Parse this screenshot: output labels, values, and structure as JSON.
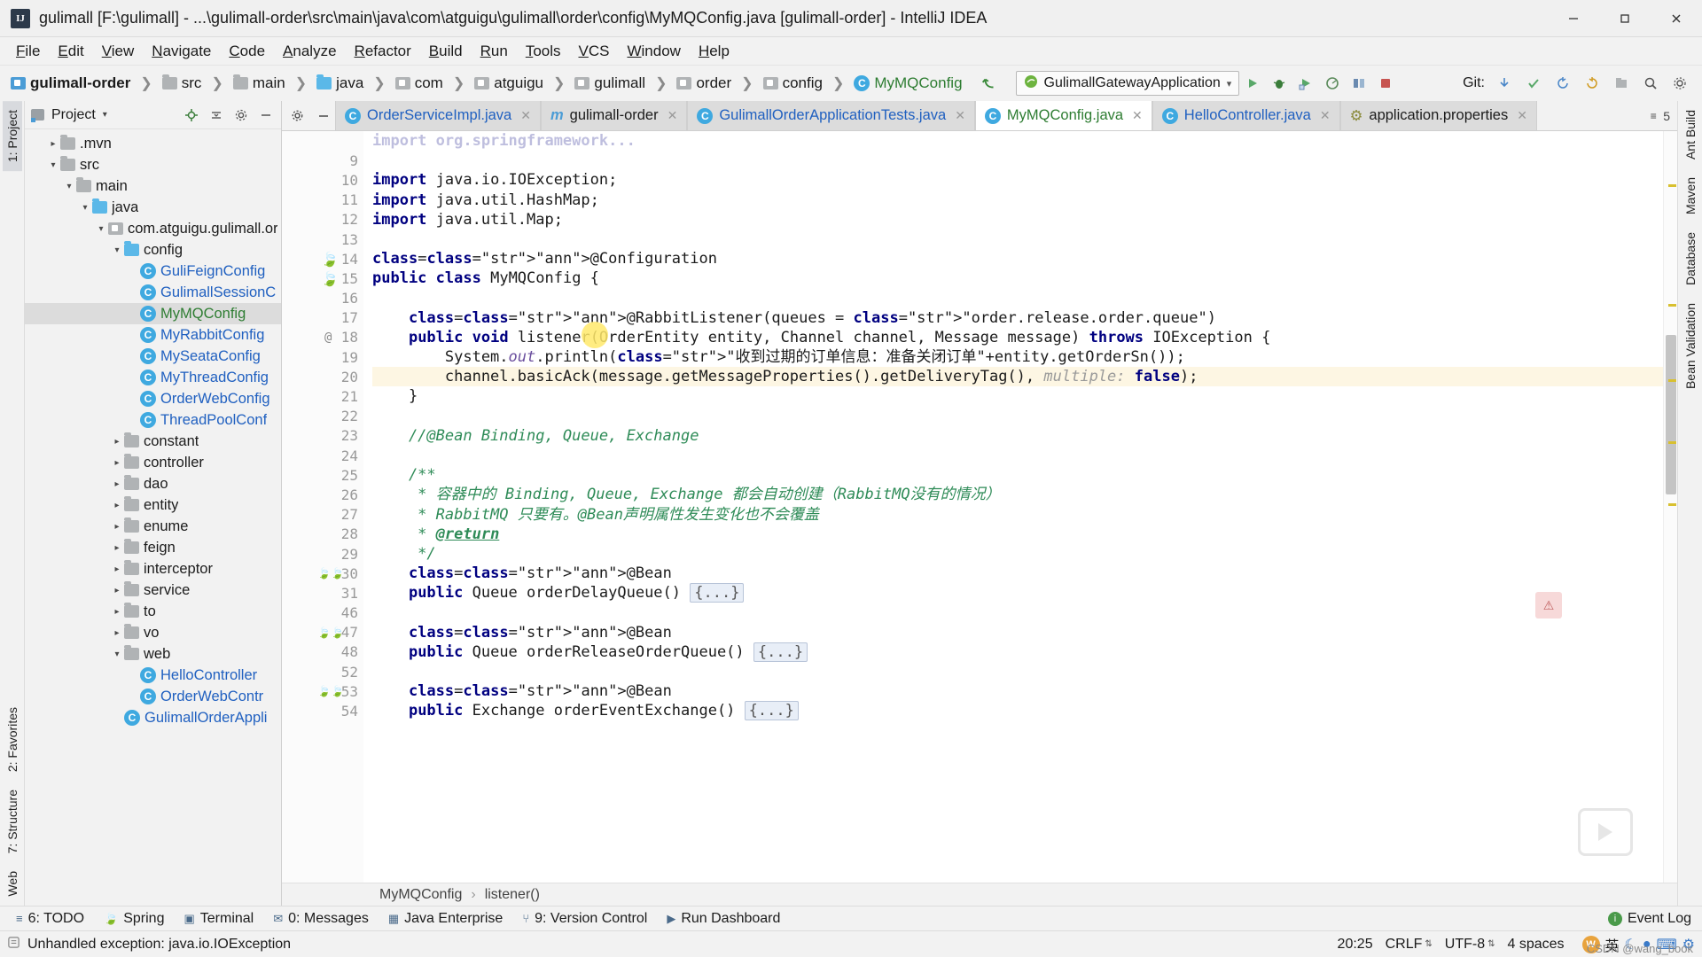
{
  "window": {
    "title": "gulimall [F:\\gulimall] - ...\\gulimall-order\\src\\main\\java\\com\\atguigu\\gulimall\\order\\config\\MyMQConfig.java [gulimall-order] - IntelliJ IDEA",
    "icon": "intellij-idea-icon",
    "minimize": "minimize-icon",
    "maximize": "restore-icon",
    "close": "close-icon"
  },
  "menubar": {
    "items": [
      {
        "label": "File"
      },
      {
        "label": "Edit"
      },
      {
        "label": "View"
      },
      {
        "label": "Navigate"
      },
      {
        "label": "Code"
      },
      {
        "label": "Analyze"
      },
      {
        "label": "Refactor"
      },
      {
        "label": "Build"
      },
      {
        "label": "Run"
      },
      {
        "label": "Tools"
      },
      {
        "label": "VCS"
      },
      {
        "label": "Window"
      },
      {
        "label": "Help"
      }
    ]
  },
  "navbar": {
    "breadcrumbs": [
      {
        "label": "gulimall-order",
        "icon": "module-icon",
        "style": "bold"
      },
      {
        "label": "src",
        "icon": "folder-grey-icon",
        "style": "normal"
      },
      {
        "label": "main",
        "icon": "folder-grey-icon",
        "style": "normal"
      },
      {
        "label": "java",
        "icon": "folder-source-blue-icon",
        "style": "normal"
      },
      {
        "label": "com",
        "icon": "package-icon",
        "style": "normal"
      },
      {
        "label": "atguigu",
        "icon": "package-icon",
        "style": "normal"
      },
      {
        "label": "gulimall",
        "icon": "package-icon",
        "style": "normal"
      },
      {
        "label": "order",
        "icon": "package-icon",
        "style": "normal"
      },
      {
        "label": "config",
        "icon": "package-icon",
        "style": "normal"
      },
      {
        "label": "MyMQConfig",
        "icon": "class-icon",
        "style": "green"
      }
    ],
    "run_config": {
      "label": "GulimallGatewayApplication",
      "icon": "spring-boot-icon",
      "dropdown": "chevron-down-icon"
    },
    "git_label": "Git:",
    "toolbar_icons": [
      "run-icon",
      "debug-icon",
      "run-with-coverage-icon",
      "profiler-icon",
      "build-icon",
      "stop-icon",
      "update-project-icon",
      "commit-icon",
      "rollback-icon",
      "search-everywhere-icon",
      "settings-icon"
    ]
  },
  "left_rail": {
    "items": [
      {
        "label": "1: Project",
        "icon": "project-icon",
        "selected": true
      },
      {
        "label": "2: Favorites",
        "icon": "favorites-icon",
        "selected": false
      },
      {
        "label": "7: Structure",
        "icon": "structure-icon",
        "selected": false
      },
      {
        "label": "Web",
        "icon": "web-icon",
        "selected": false
      }
    ]
  },
  "right_rail": {
    "items": [
      {
        "label": "Ant Build",
        "icon": "ant-icon"
      },
      {
        "label": "Maven",
        "icon": "maven-icon"
      },
      {
        "label": "Database",
        "icon": "database-icon"
      },
      {
        "label": "Bean Validation",
        "icon": "bean-validation-icon"
      }
    ]
  },
  "project_panel": {
    "title": "Project",
    "title_caret": "chevron-down-icon",
    "header_icons": [
      "locate-icon",
      "collapse-all-icon",
      "settings-gear-icon",
      "hide-icon"
    ],
    "tree": [
      {
        "depth": 1,
        "label": ".mvn",
        "arrow": "right",
        "icon": "folder",
        "color": "default",
        "selected": false
      },
      {
        "depth": 1,
        "label": "src",
        "arrow": "down",
        "icon": "folder",
        "color": "default",
        "selected": false
      },
      {
        "depth": 2,
        "label": "main",
        "arrow": "down",
        "icon": "folder",
        "color": "default",
        "selected": false
      },
      {
        "depth": 3,
        "label": "java",
        "arrow": "down",
        "icon": "folder-blue",
        "color": "default",
        "selected": false
      },
      {
        "depth": 4,
        "label": "com.atguigu.gulimall.or",
        "arrow": "down",
        "icon": "package",
        "color": "default",
        "selected": false
      },
      {
        "depth": 5,
        "label": "config",
        "arrow": "down",
        "icon": "folder-blue",
        "color": "default",
        "selected": false
      },
      {
        "depth": 6,
        "label": "GuliFeignConfig",
        "arrow": "none",
        "icon": "class",
        "color": "blue",
        "selected": false
      },
      {
        "depth": 6,
        "label": "GulimallSessionC",
        "arrow": "none",
        "icon": "class",
        "color": "blue",
        "selected": false
      },
      {
        "depth": 6,
        "label": "MyMQConfig",
        "arrow": "none",
        "icon": "class",
        "color": "green",
        "selected": true
      },
      {
        "depth": 6,
        "label": "MyRabbitConfig",
        "arrow": "none",
        "icon": "class",
        "color": "blue",
        "selected": false
      },
      {
        "depth": 6,
        "label": "MySeataConfig",
        "arrow": "none",
        "icon": "class",
        "color": "blue",
        "selected": false
      },
      {
        "depth": 6,
        "label": "MyThreadConfig",
        "arrow": "none",
        "icon": "class",
        "color": "blue",
        "selected": false
      },
      {
        "depth": 6,
        "label": "OrderWebConfig",
        "arrow": "none",
        "icon": "class",
        "color": "blue",
        "selected": false
      },
      {
        "depth": 6,
        "label": "ThreadPoolConf",
        "arrow": "none",
        "icon": "class",
        "color": "blue",
        "selected": false
      },
      {
        "depth": 5,
        "label": "constant",
        "arrow": "right",
        "icon": "folder",
        "color": "default",
        "selected": false
      },
      {
        "depth": 5,
        "label": "controller",
        "arrow": "right",
        "icon": "folder",
        "color": "default",
        "selected": false
      },
      {
        "depth": 5,
        "label": "dao",
        "arrow": "right",
        "icon": "folder",
        "color": "default",
        "selected": false
      },
      {
        "depth": 5,
        "label": "entity",
        "arrow": "right",
        "icon": "folder",
        "color": "default",
        "selected": false
      },
      {
        "depth": 5,
        "label": "enume",
        "arrow": "right",
        "icon": "folder",
        "color": "default",
        "selected": false
      },
      {
        "depth": 5,
        "label": "feign",
        "arrow": "right",
        "icon": "folder",
        "color": "default",
        "selected": false
      },
      {
        "depth": 5,
        "label": "interceptor",
        "arrow": "right",
        "icon": "folder",
        "color": "default",
        "selected": false
      },
      {
        "depth": 5,
        "label": "service",
        "arrow": "right",
        "icon": "folder",
        "color": "default",
        "selected": false
      },
      {
        "depth": 5,
        "label": "to",
        "arrow": "right",
        "icon": "folder",
        "color": "default",
        "selected": false
      },
      {
        "depth": 5,
        "label": "vo",
        "arrow": "right",
        "icon": "folder",
        "color": "default",
        "selected": false
      },
      {
        "depth": 5,
        "label": "web",
        "arrow": "down",
        "icon": "folder",
        "color": "default",
        "selected": false
      },
      {
        "depth": 6,
        "label": "HelloController",
        "arrow": "none",
        "icon": "class",
        "color": "blue",
        "selected": false
      },
      {
        "depth": 6,
        "label": "OrderWebContr",
        "arrow": "none",
        "icon": "class",
        "color": "blue",
        "selected": false
      },
      {
        "depth": 5,
        "label": "GulimallOrderAppli",
        "arrow": "none",
        "icon": "class-spring",
        "color": "blue",
        "selected": false
      }
    ]
  },
  "editor_tabs": {
    "gear_icon": "settings-gear-icon",
    "minimize_icon": "minimize-icon",
    "tabs": [
      {
        "label": "OrderServiceImpl.java",
        "icon": "java-class-icon",
        "active": false,
        "color": "blue",
        "close": "close-icon"
      },
      {
        "label": "gulimall-order",
        "icon": "maven-module-icon",
        "active": false,
        "color": "default",
        "close": "close-icon"
      },
      {
        "label": "GulimallOrderApplicationTests.java",
        "icon": "java-test-class-icon",
        "active": false,
        "color": "blue",
        "close": "close-icon"
      },
      {
        "label": "MyMQConfig.java",
        "icon": "java-class-icon",
        "active": true,
        "color": "green",
        "close": "close-icon"
      },
      {
        "label": "HelloController.java",
        "icon": "java-class-icon",
        "active": false,
        "color": "blue",
        "close": "close-icon"
      },
      {
        "label": "application.properties",
        "icon": "properties-icon",
        "active": false,
        "color": "default",
        "close": "close-icon"
      }
    ],
    "more_label": "5",
    "more_icon": "tab-list-icon"
  },
  "editor": {
    "first_visible_line": 8,
    "lines": [
      {
        "num": "",
        "text": "import org.springframework...",
        "truncated": true
      },
      {
        "num": "9",
        "text": ""
      },
      {
        "num": "10",
        "text": "import java.io.IOException;"
      },
      {
        "num": "11",
        "text": "import java.util.HashMap;"
      },
      {
        "num": "12",
        "text": "import java.util.Map;"
      },
      {
        "num": "13",
        "text": ""
      },
      {
        "num": "14",
        "text": "@Configuration"
      },
      {
        "num": "15",
        "text": "public class MyMQConfig {"
      },
      {
        "num": "16",
        "text": ""
      },
      {
        "num": "17",
        "text": "    @RabbitListener(queues = \"order.release.order.queue\")"
      },
      {
        "num": "18",
        "text": "    public void listener(OrderEntity entity, Channel channel, Message message) throws IOException {"
      },
      {
        "num": "19",
        "text": "        System.out.println(\"收到过期的订单信息：准备关闭订单\"+entity.getOrderSn());"
      },
      {
        "num": "20",
        "text": "        channel.basicAck(message.getMessageProperties().getDeliveryTag(), multiple: false);",
        "highlighted": true
      },
      {
        "num": "21",
        "text": "    }"
      },
      {
        "num": "22",
        "text": ""
      },
      {
        "num": "23",
        "text": "    //@Bean Binding, Queue, Exchange"
      },
      {
        "num": "24",
        "text": ""
      },
      {
        "num": "25",
        "text": "    /**"
      },
      {
        "num": "26",
        "text": "     * 容器中的 Binding, Queue, Exchange 都会自动创建（RabbitMQ没有的情况）"
      },
      {
        "num": "27",
        "text": "     * RabbitMQ 只要有。@Bean声明属性发生变化也不会覆盖"
      },
      {
        "num": "28",
        "text": "     * @return"
      },
      {
        "num": "29",
        "text": "     */"
      },
      {
        "num": "30",
        "text": "    @Bean"
      },
      {
        "num": "31",
        "text": "    public Queue orderDelayQueue() {...}"
      },
      {
        "num": "46",
        "text": ""
      },
      {
        "num": "47",
        "text": "    @Bean"
      },
      {
        "num": "48",
        "text": "    public Queue orderReleaseOrderQueue() {...}"
      },
      {
        "num": "52",
        "text": ""
      },
      {
        "num": "53",
        "text": "    @Bean"
      },
      {
        "num": "54",
        "text": "    public Exchange orderEventExchange() {...}"
      }
    ],
    "inlay_hint": "multiple:",
    "breadcrumb": [
      "MyMQConfig",
      "listener()"
    ],
    "breadcrumb_sep": "chevron-right-icon"
  },
  "tool_windows": {
    "items": [
      {
        "label": "6: TODO",
        "num": "6",
        "icon": "todo-icon"
      },
      {
        "label": "Spring",
        "icon": "spring-icon"
      },
      {
        "label": "Terminal",
        "icon": "terminal-icon"
      },
      {
        "label": "0: Messages",
        "icon": "messages-icon"
      },
      {
        "label": "Java Enterprise",
        "icon": "java-enterprise-icon"
      },
      {
        "label": "9: Version Control",
        "icon": "version-control-icon"
      },
      {
        "label": "Run Dashboard",
        "icon": "run-dashboard-icon"
      }
    ],
    "event_log": {
      "label": "Event Log",
      "icon": "event-log-icon"
    }
  },
  "statusbar": {
    "message": "Unhandled exception: java.io.IOException",
    "message_icon": "warning-icon",
    "position": "20:25",
    "line_separator": "CRLF",
    "encoding": "UTF-8",
    "indent": "4 spaces",
    "ime_lang": "英",
    "ime_icons": [
      "ime-logo-icon",
      "ime-moon-icon",
      "ime-dot-icon",
      "ime-keyboard-icon",
      "ime-settings-icon"
    ],
    "watermark": "CSDN @wang_book"
  }
}
